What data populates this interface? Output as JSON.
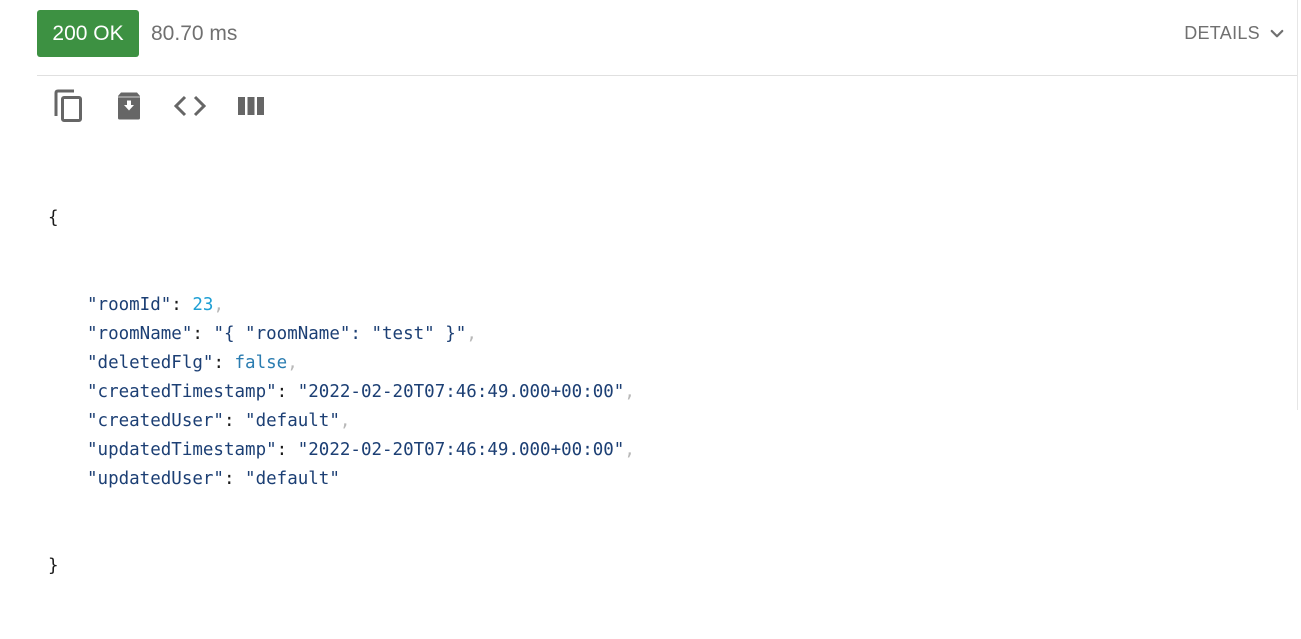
{
  "status": {
    "code_label": "200 OK",
    "time": "80.70 ms",
    "details_label": "DETAILS",
    "badge_color": "#3d9142"
  },
  "toolbar": {
    "icons": [
      "copy-icon",
      "download-icon",
      "code-icon",
      "columns-icon"
    ]
  },
  "response": {
    "open_brace": "{",
    "close_brace": "}",
    "fields": [
      {
        "key": "\"roomId\"",
        "value": "23",
        "type": "number",
        "comma": ","
      },
      {
        "key": "\"roomName\"",
        "value": "\"{ \"roomName\": \"test\" }\"",
        "type": "string",
        "comma": ","
      },
      {
        "key": "\"deletedFlg\"",
        "value": "false",
        "type": "boolean",
        "comma": ","
      },
      {
        "key": "\"createdTimestamp\"",
        "value": "\"2022-02-20T07:46:49.000+00:00\"",
        "type": "string",
        "comma": ","
      },
      {
        "key": "\"createdUser\"",
        "value": "\"default\"",
        "type": "string",
        "comma": ","
      },
      {
        "key": "\"updatedTimestamp\"",
        "value": "\"2022-02-20T07:46:49.000+00:00\"",
        "type": "string",
        "comma": ","
      },
      {
        "key": "\"updatedUser\"",
        "value": "\"default\"",
        "type": "string",
        "comma": ""
      }
    ]
  }
}
